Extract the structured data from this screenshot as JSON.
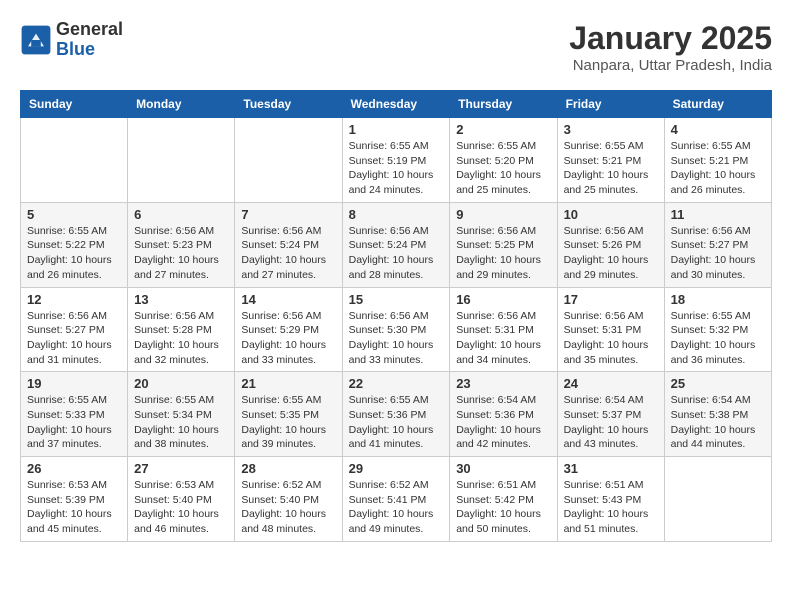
{
  "logo": {
    "general": "General",
    "blue": "Blue"
  },
  "header": {
    "month": "January 2025",
    "location": "Nanpara, Uttar Pradesh, India"
  },
  "weekdays": [
    "Sunday",
    "Monday",
    "Tuesday",
    "Wednesday",
    "Thursday",
    "Friday",
    "Saturday"
  ],
  "weeks": [
    [
      {
        "day": "",
        "info": ""
      },
      {
        "day": "",
        "info": ""
      },
      {
        "day": "",
        "info": ""
      },
      {
        "day": "1",
        "info": "Sunrise: 6:55 AM\nSunset: 5:19 PM\nDaylight: 10 hours\nand 24 minutes."
      },
      {
        "day": "2",
        "info": "Sunrise: 6:55 AM\nSunset: 5:20 PM\nDaylight: 10 hours\nand 25 minutes."
      },
      {
        "day": "3",
        "info": "Sunrise: 6:55 AM\nSunset: 5:21 PM\nDaylight: 10 hours\nand 25 minutes."
      },
      {
        "day": "4",
        "info": "Sunrise: 6:55 AM\nSunset: 5:21 PM\nDaylight: 10 hours\nand 26 minutes."
      }
    ],
    [
      {
        "day": "5",
        "info": "Sunrise: 6:55 AM\nSunset: 5:22 PM\nDaylight: 10 hours\nand 26 minutes."
      },
      {
        "day": "6",
        "info": "Sunrise: 6:56 AM\nSunset: 5:23 PM\nDaylight: 10 hours\nand 27 minutes."
      },
      {
        "day": "7",
        "info": "Sunrise: 6:56 AM\nSunset: 5:24 PM\nDaylight: 10 hours\nand 27 minutes."
      },
      {
        "day": "8",
        "info": "Sunrise: 6:56 AM\nSunset: 5:24 PM\nDaylight: 10 hours\nand 28 minutes."
      },
      {
        "day": "9",
        "info": "Sunrise: 6:56 AM\nSunset: 5:25 PM\nDaylight: 10 hours\nand 29 minutes."
      },
      {
        "day": "10",
        "info": "Sunrise: 6:56 AM\nSunset: 5:26 PM\nDaylight: 10 hours\nand 29 minutes."
      },
      {
        "day": "11",
        "info": "Sunrise: 6:56 AM\nSunset: 5:27 PM\nDaylight: 10 hours\nand 30 minutes."
      }
    ],
    [
      {
        "day": "12",
        "info": "Sunrise: 6:56 AM\nSunset: 5:27 PM\nDaylight: 10 hours\nand 31 minutes."
      },
      {
        "day": "13",
        "info": "Sunrise: 6:56 AM\nSunset: 5:28 PM\nDaylight: 10 hours\nand 32 minutes."
      },
      {
        "day": "14",
        "info": "Sunrise: 6:56 AM\nSunset: 5:29 PM\nDaylight: 10 hours\nand 33 minutes."
      },
      {
        "day": "15",
        "info": "Sunrise: 6:56 AM\nSunset: 5:30 PM\nDaylight: 10 hours\nand 33 minutes."
      },
      {
        "day": "16",
        "info": "Sunrise: 6:56 AM\nSunset: 5:31 PM\nDaylight: 10 hours\nand 34 minutes."
      },
      {
        "day": "17",
        "info": "Sunrise: 6:56 AM\nSunset: 5:31 PM\nDaylight: 10 hours\nand 35 minutes."
      },
      {
        "day": "18",
        "info": "Sunrise: 6:55 AM\nSunset: 5:32 PM\nDaylight: 10 hours\nand 36 minutes."
      }
    ],
    [
      {
        "day": "19",
        "info": "Sunrise: 6:55 AM\nSunset: 5:33 PM\nDaylight: 10 hours\nand 37 minutes."
      },
      {
        "day": "20",
        "info": "Sunrise: 6:55 AM\nSunset: 5:34 PM\nDaylight: 10 hours\nand 38 minutes."
      },
      {
        "day": "21",
        "info": "Sunrise: 6:55 AM\nSunset: 5:35 PM\nDaylight: 10 hours\nand 39 minutes."
      },
      {
        "day": "22",
        "info": "Sunrise: 6:55 AM\nSunset: 5:36 PM\nDaylight: 10 hours\nand 41 minutes."
      },
      {
        "day": "23",
        "info": "Sunrise: 6:54 AM\nSunset: 5:36 PM\nDaylight: 10 hours\nand 42 minutes."
      },
      {
        "day": "24",
        "info": "Sunrise: 6:54 AM\nSunset: 5:37 PM\nDaylight: 10 hours\nand 43 minutes."
      },
      {
        "day": "25",
        "info": "Sunrise: 6:54 AM\nSunset: 5:38 PM\nDaylight: 10 hours\nand 44 minutes."
      }
    ],
    [
      {
        "day": "26",
        "info": "Sunrise: 6:53 AM\nSunset: 5:39 PM\nDaylight: 10 hours\nand 45 minutes."
      },
      {
        "day": "27",
        "info": "Sunrise: 6:53 AM\nSunset: 5:40 PM\nDaylight: 10 hours\nand 46 minutes."
      },
      {
        "day": "28",
        "info": "Sunrise: 6:52 AM\nSunset: 5:40 PM\nDaylight: 10 hours\nand 48 minutes."
      },
      {
        "day": "29",
        "info": "Sunrise: 6:52 AM\nSunset: 5:41 PM\nDaylight: 10 hours\nand 49 minutes."
      },
      {
        "day": "30",
        "info": "Sunrise: 6:51 AM\nSunset: 5:42 PM\nDaylight: 10 hours\nand 50 minutes."
      },
      {
        "day": "31",
        "info": "Sunrise: 6:51 AM\nSunset: 5:43 PM\nDaylight: 10 hours\nand 51 minutes."
      },
      {
        "day": "",
        "info": ""
      }
    ]
  ]
}
